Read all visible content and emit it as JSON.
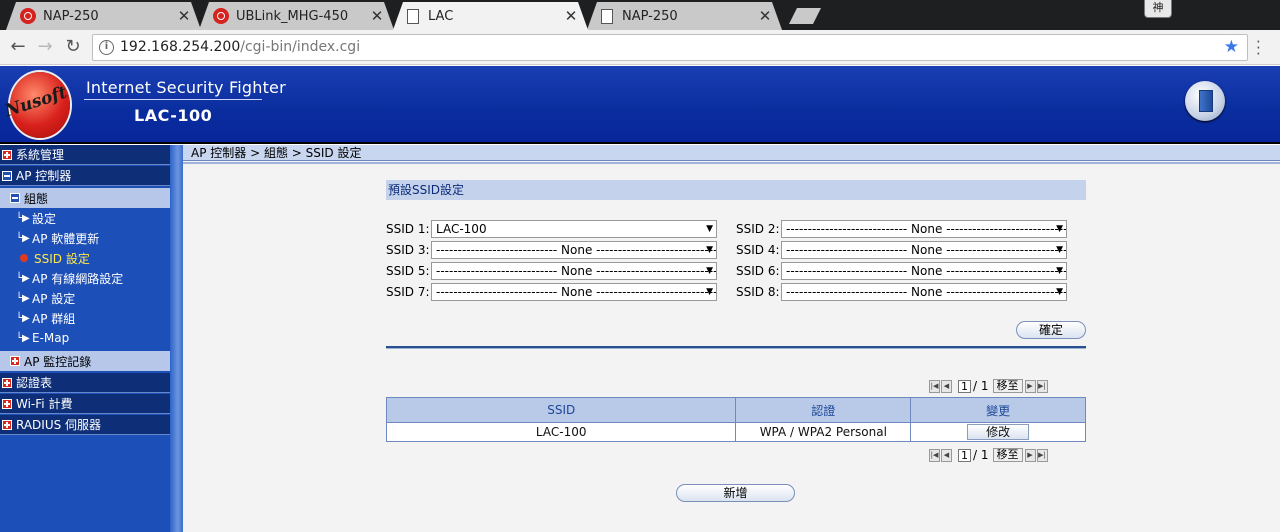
{
  "browser": {
    "tabs": [
      {
        "title": "NAP-250",
        "icon": "nusoft-favicon"
      },
      {
        "title": "UBLink_MHG-450",
        "icon": "nusoft-favicon"
      },
      {
        "title": "LAC",
        "icon": "document-icon",
        "active": true
      },
      {
        "title": "NAP-250",
        "icon": "document-icon"
      }
    ],
    "profile_label": "神",
    "url_host": "192.168.254.200",
    "url_path": "/cgi-bin/index.cgi"
  },
  "banner": {
    "logo_text": "Nusoft",
    "title": "Internet Security Fighter",
    "model": "LAC-100"
  },
  "sidebar": {
    "items": [
      {
        "label": "系統管理",
        "type": "cat",
        "marker": "plus"
      },
      {
        "label": "AP 控制器",
        "type": "cat",
        "marker": "minus"
      },
      {
        "label": "組態",
        "type": "sub",
        "marker": "minus"
      },
      {
        "label": "設定",
        "type": "link"
      },
      {
        "label": "AP 軟體更新",
        "type": "link"
      },
      {
        "label": "SSID 設定",
        "type": "link",
        "current": true
      },
      {
        "label": "AP 有線網路設定",
        "type": "link"
      },
      {
        "label": "AP 設定",
        "type": "link"
      },
      {
        "label": "AP 群組",
        "type": "link"
      },
      {
        "label": "E-Map",
        "type": "link"
      },
      {
        "label": "AP 監控記錄",
        "type": "sub",
        "marker": "plus"
      },
      {
        "label": "認證表",
        "type": "cat",
        "marker": "plus"
      },
      {
        "label": "Wi-Fi 計費",
        "type": "cat",
        "marker": "plus"
      },
      {
        "label": "RADIUS 伺服器",
        "type": "cat",
        "marker": "plus"
      }
    ]
  },
  "main": {
    "breadcrumb": "AP 控制器 > 組態 > SSID 設定",
    "section_title": "預設SSID設定",
    "ssid_slots": [
      {
        "label": "SSID 1:",
        "value": "LAC-100"
      },
      {
        "label": "SSID 2:",
        "value": "---------------------------- None ----------------------------"
      },
      {
        "label": "SSID 3:",
        "value": "---------------------------- None ----------------------------"
      },
      {
        "label": "SSID 4:",
        "value": "---------------------------- None ----------------------------"
      },
      {
        "label": "SSID 5:",
        "value": "---------------------------- None ----------------------------"
      },
      {
        "label": "SSID 6:",
        "value": "---------------------------- None ----------------------------"
      },
      {
        "label": "SSID 7:",
        "value": "---------------------------- None ----------------------------"
      },
      {
        "label": "SSID 8:",
        "value": "---------------------------- None ----------------------------"
      }
    ],
    "confirm_label": "確定",
    "pager": {
      "page": "1",
      "total_text": "/ 1",
      "go_label": "移至"
    },
    "table": {
      "headers": [
        "SSID",
        "認證",
        "變更"
      ],
      "rows": [
        {
          "ssid": "LAC-100",
          "auth": "WPA / WPA2 Personal",
          "action": "修改"
        }
      ]
    },
    "add_label": "新增"
  }
}
